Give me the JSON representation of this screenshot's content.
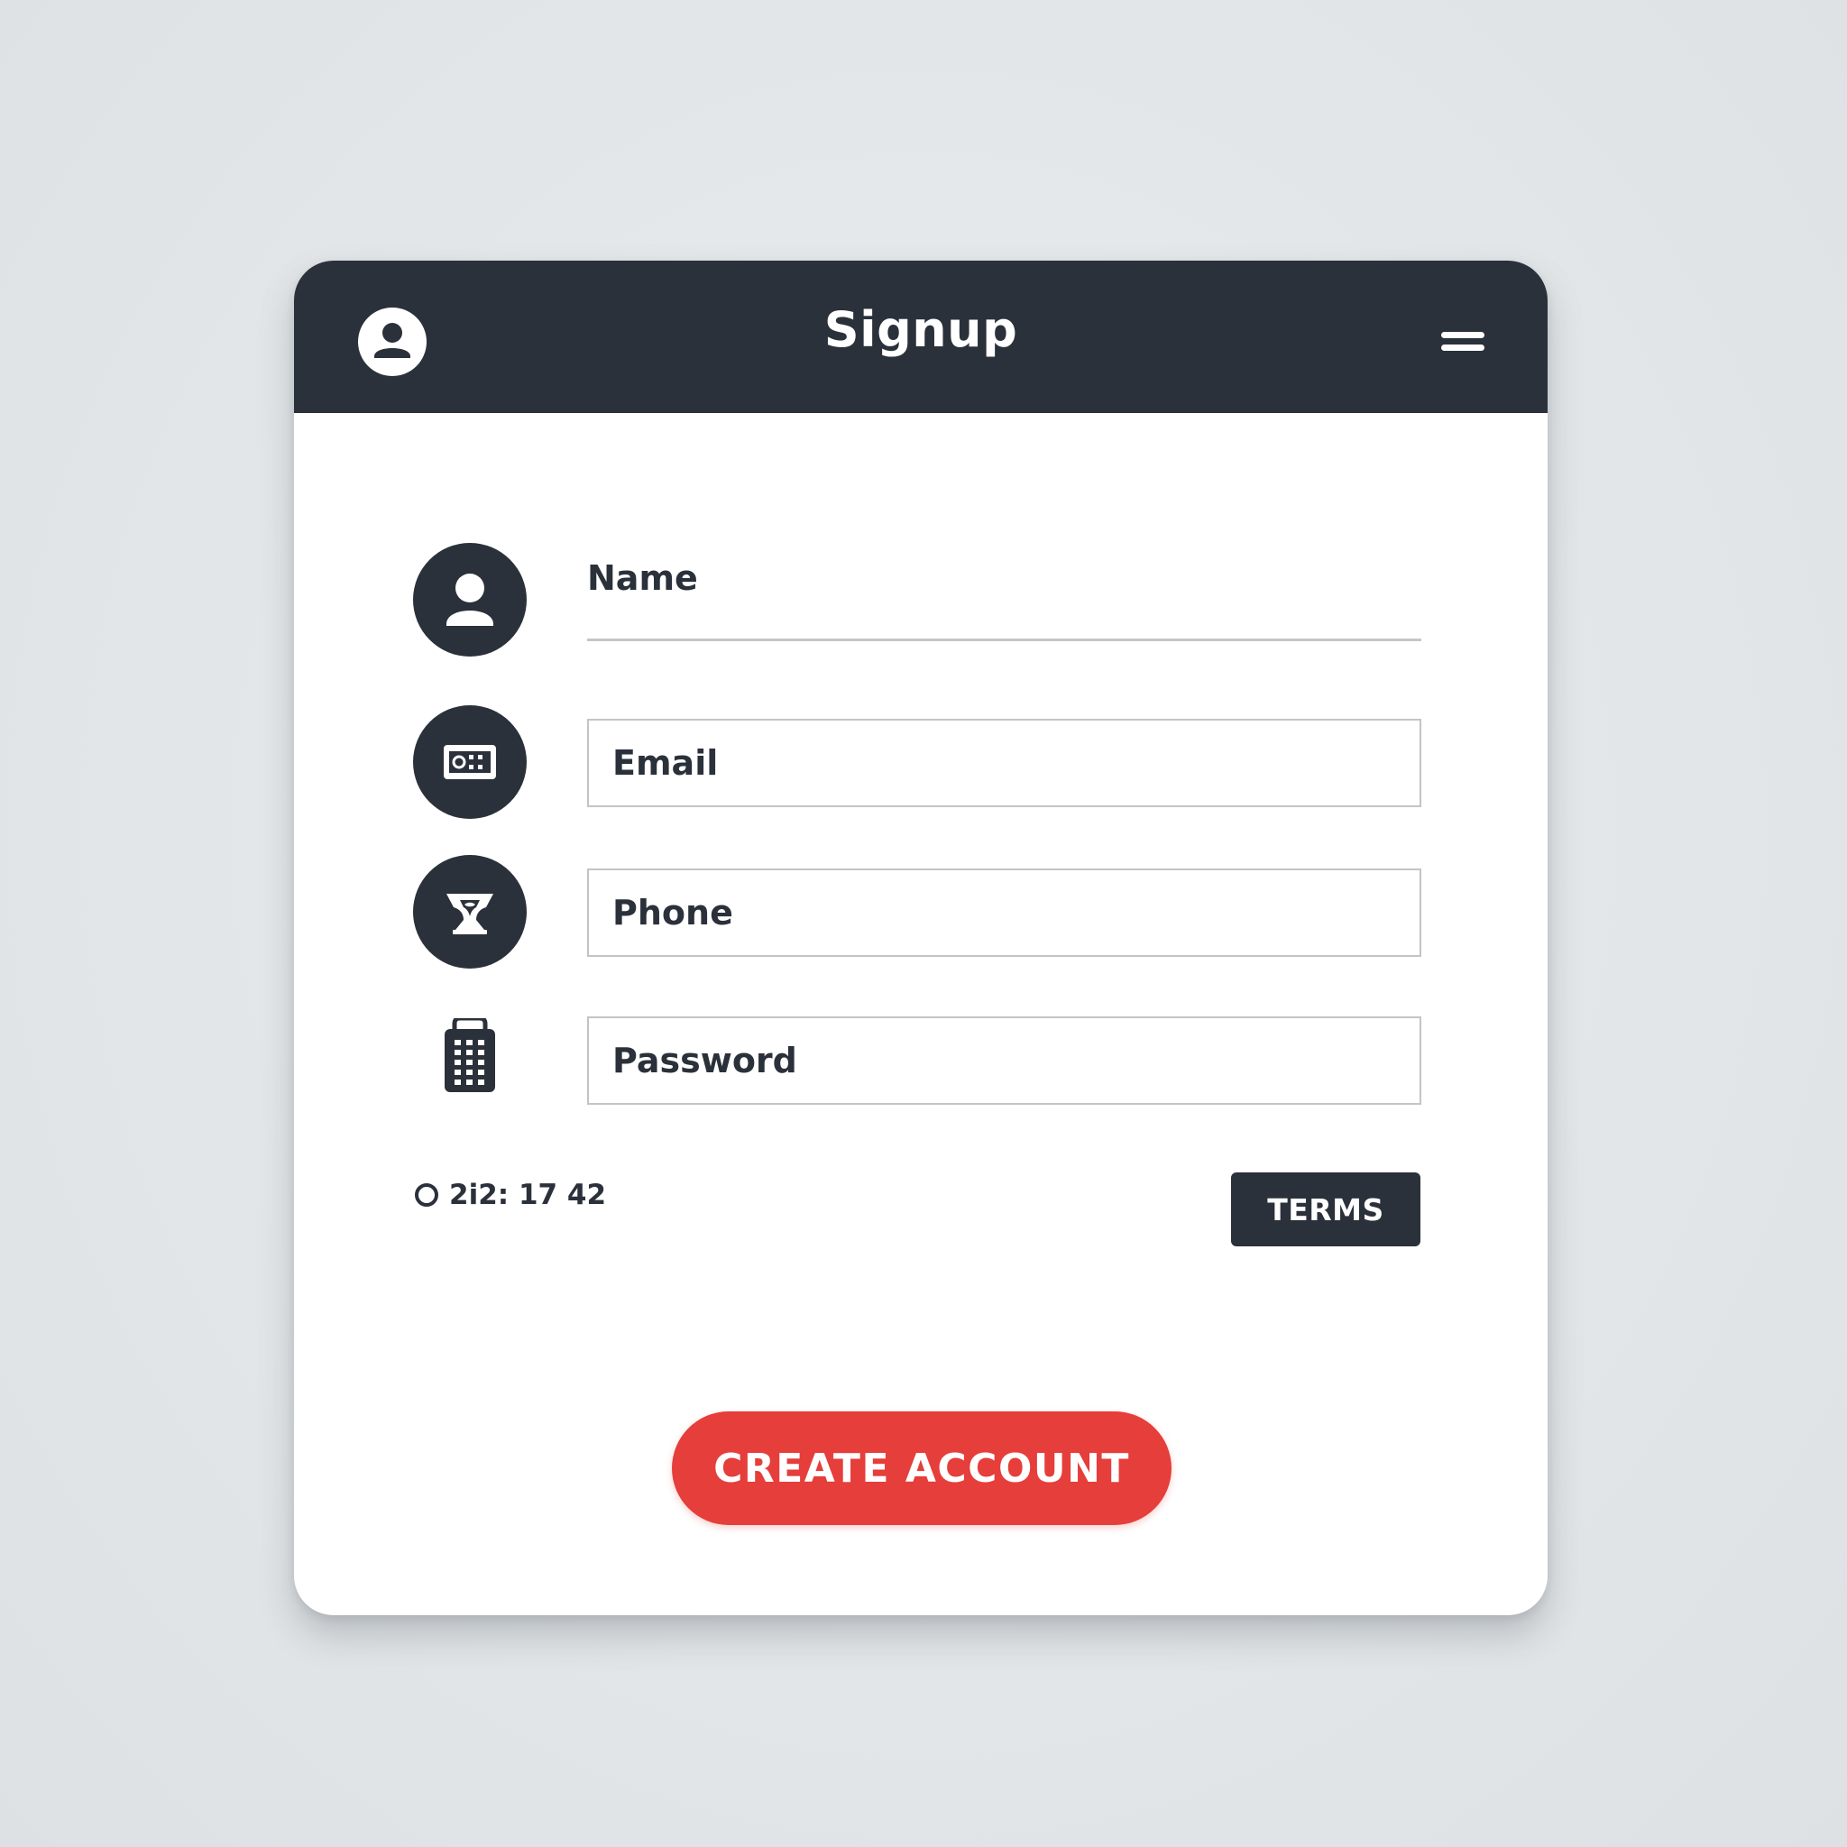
{
  "header": {
    "title": "Signup",
    "avatar_icon": "user-circle-icon",
    "menu_icon": "hamburger-menu-icon"
  },
  "form": {
    "name": {
      "label": "Name",
      "icon": "person-icon"
    },
    "email": {
      "placeholder": "Email",
      "icon": "id-card-icon"
    },
    "phone": {
      "placeholder": "Phone",
      "icon": "phone-handset-icon"
    },
    "password": {
      "placeholder": "Password",
      "icon": "keypad-phone-icon"
    }
  },
  "footer": {
    "status_text": "2i2: 17 42",
    "terms_label": "TERMS"
  },
  "actions": {
    "create_label": "CREATE ACCOUNT"
  },
  "colors": {
    "dark": "#2b313a",
    "accent": "#e53e3b",
    "background": "#dfe3e6",
    "card": "#ffffff"
  }
}
